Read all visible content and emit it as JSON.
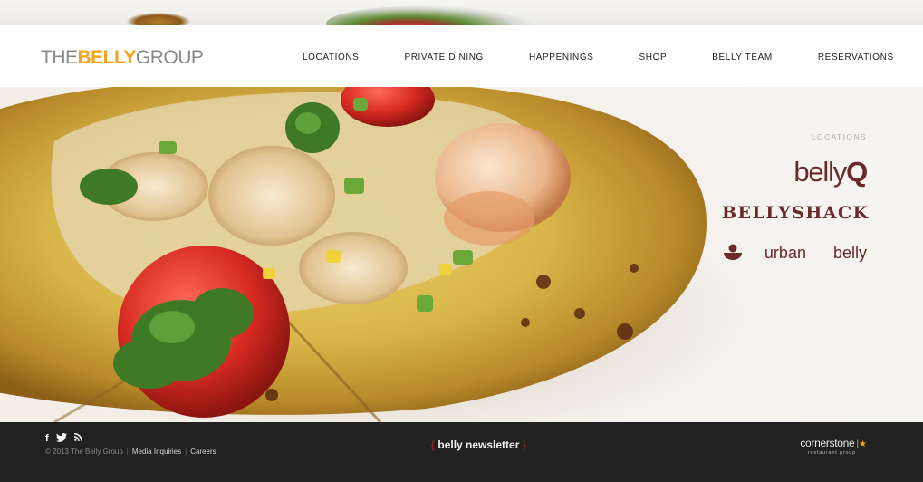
{
  "logo": {
    "part1": "THE",
    "part2": "BELLY",
    "part3": "GROUP"
  },
  "nav": {
    "items": [
      {
        "label": "LOCATIONS"
      },
      {
        "label": "PRIVATE DINING"
      },
      {
        "label": "HAPPENINGS"
      },
      {
        "label": "SHOP"
      },
      {
        "label": "BELLY TEAM"
      },
      {
        "label": "RESERVATIONS"
      }
    ]
  },
  "locations": {
    "heading": "LOCATIONS",
    "bellyq": {
      "main": "belly",
      "accent": "Q"
    },
    "bellyshack": "BELLYSHACK",
    "urbanbelly": {
      "left": "urban",
      "right": "belly"
    }
  },
  "footer": {
    "social": {
      "facebook": "f",
      "twitter": "t",
      "rss": "rss"
    },
    "copyright": "© 2013 The Belly Group",
    "media_inquiries": "Media Inquiries",
    "careers": "Careers",
    "newsletter": {
      "open": "{",
      "label": "belly newsletter",
      "close": "}"
    },
    "cornerstone": {
      "name": "cornerstone",
      "sub": "restaurant group"
    }
  },
  "colors": {
    "accent": "#f2a51c",
    "maroon": "#6b2a2a",
    "footer_bg": "#222121",
    "newsletter_brace": "#c2292d"
  }
}
